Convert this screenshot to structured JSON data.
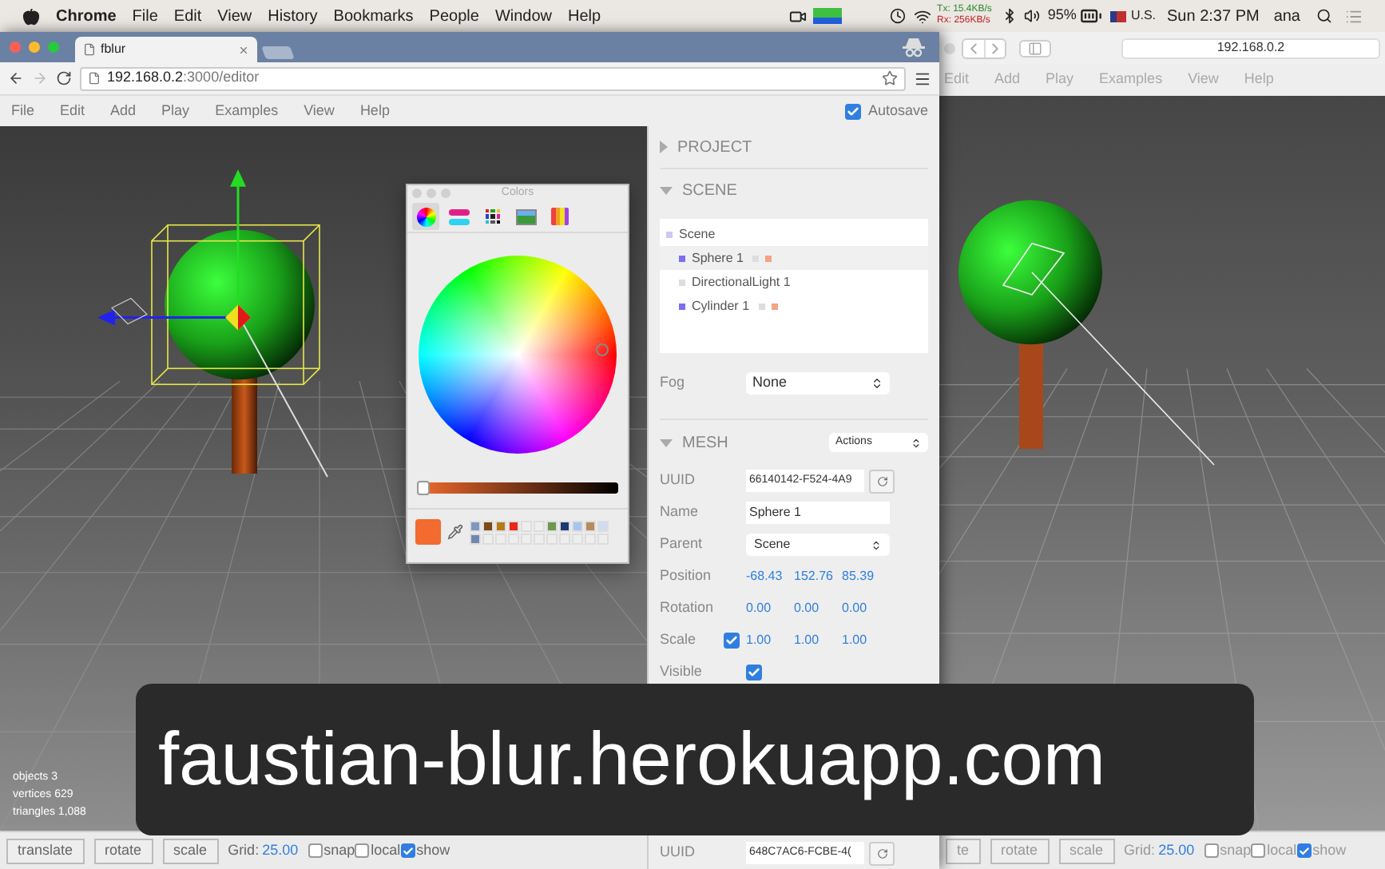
{
  "menubar": {
    "app": "Chrome",
    "items": [
      "File",
      "Edit",
      "View",
      "History",
      "Bookmarks",
      "People",
      "Window",
      "Help"
    ],
    "status": {
      "tx_label": "Tx:",
      "tx_value": "15.4KB/s",
      "rx_label": "Rx:",
      "rx_value": "256KB/s",
      "battery": "95%",
      "input": "U.S.",
      "clock": "Sun 2:37 PM",
      "user": "ana"
    }
  },
  "browser": {
    "tab": "fblur",
    "url_host": "192.168.0.2",
    "url_path": ":3000/editor"
  },
  "editor": {
    "menu": [
      "File",
      "Edit",
      "Add",
      "Play",
      "Examples",
      "View",
      "Help"
    ],
    "autosave": {
      "label": "Autosave",
      "checked": true
    },
    "stats": [
      {
        "label": "objects",
        "value": "3"
      },
      {
        "label": "vertices",
        "value": "629"
      },
      {
        "label": "triangles",
        "value": "1,088"
      }
    ],
    "toolbar": {
      "buttons": [
        "translate",
        "rotate",
        "scale"
      ],
      "grid_label": "Grid:",
      "grid_value": "25.00",
      "toggles": [
        {
          "label": "snap",
          "checked": false
        },
        {
          "label": "local",
          "checked": false
        },
        {
          "label": "show",
          "checked": true
        }
      ]
    },
    "project": {
      "title": "PROJECT",
      "expanded": false
    },
    "scene": {
      "title": "SCENE",
      "expanded": true,
      "outliner": [
        {
          "name": "Scene",
          "kind": "scene",
          "selected": false,
          "children": [
            {
              "name": "Sphere 1",
              "kind": "mesh",
              "selected": true
            },
            {
              "name": "DirectionalLight 1",
              "kind": "light",
              "selected": false
            },
            {
              "name": "Cylinder 1",
              "kind": "mesh",
              "selected": false
            }
          ]
        }
      ],
      "fog": {
        "label": "Fog",
        "value": "None"
      }
    },
    "mesh": {
      "title": "MESH",
      "expanded": true,
      "actions": "Actions",
      "uuid": {
        "label": "UUID",
        "value": "66140142-F524-4A9"
      },
      "name": {
        "label": "Name",
        "value": "Sphere 1"
      },
      "parent": {
        "label": "Parent",
        "value": "Scene"
      },
      "vectors": [
        {
          "label": "Position",
          "values": [
            "-68.43",
            "152.76",
            "85.39"
          ]
        },
        {
          "label": "Rotation",
          "values": [
            "0.00",
            "0.00",
            "0.00"
          ]
        },
        {
          "label": "Scale",
          "locked": true,
          "values": [
            "1.00",
            "1.00",
            "1.00"
          ]
        }
      ],
      "visible": {
        "label": "Visible",
        "checked": true
      }
    },
    "material_uuid": {
      "label": "UUID",
      "value": "648C7AC6-FCBE-4("
    }
  },
  "colors": {
    "title": "Colors",
    "tabs": [
      {
        "kind": "wheel",
        "selected": true
      },
      {
        "kind": "sliders",
        "selected": false
      },
      {
        "kind": "palettes",
        "selected": false
      },
      {
        "kind": "image",
        "selected": false
      },
      {
        "kind": "pencils",
        "selected": false
      }
    ],
    "brightness": {
      "level": 0.0
    },
    "current": {
      "color": "#f26b2f"
    },
    "swatches": [
      {
        "color": "#8296c0"
      },
      {
        "color": "#7a4a16"
      },
      {
        "color": "#b47a1c"
      },
      {
        "color": "#e8281a"
      },
      {
        "color": "#eeeeee"
      },
      {
        "color": "#eeeeee"
      },
      {
        "color": "#6c9a4c"
      },
      {
        "color": "#1e3a6e"
      },
      {
        "color": "#a8c4ee"
      },
      {
        "color": "#b88a5e"
      },
      {
        "color": "#cfdcf0"
      },
      {
        "color": "#7088b0"
      },
      {
        "color": "#eeeeee"
      },
      {
        "color": "#eeeeee"
      },
      {
        "color": "#eeeeee"
      },
      {
        "color": "#eeeeee"
      },
      {
        "color": "#eeeeee"
      },
      {
        "color": "#eeeeee"
      },
      {
        "color": "#eeeeee"
      },
      {
        "color": "#eeeeee"
      },
      {
        "color": "#eeeeee"
      },
      {
        "color": "#eeeeee"
      }
    ]
  },
  "second_window": {
    "url": "192.168.0.2",
    "menu": [
      "Edit",
      "Add",
      "Play",
      "Examples",
      "View",
      "Help"
    ],
    "toolbar": {
      "buttons": [
        "te",
        "rotate",
        "scale"
      ],
      "grid_label": "Grid:",
      "grid_value": "25.00",
      "toggles": [
        {
          "label": "snap",
          "checked": false
        },
        {
          "label": "local",
          "checked": false
        },
        {
          "label": "show",
          "checked": true
        }
      ]
    }
  },
  "caption": "faustian-blur.herokuapp.com"
}
